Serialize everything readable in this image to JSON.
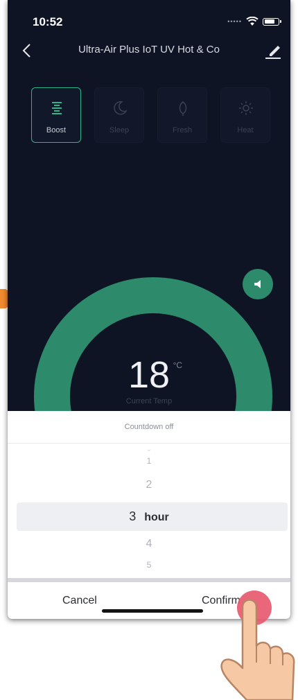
{
  "status": {
    "time": "10:52"
  },
  "nav": {
    "title": "Ultra-Air Plus IoT UV Hot & Co"
  },
  "modes": [
    {
      "label": "Boost",
      "icon": "boost-icon",
      "active": true
    },
    {
      "label": "Sleep",
      "icon": "moon-icon",
      "active": false
    },
    {
      "label": "Fresh",
      "icon": "leaf-icon",
      "active": false
    },
    {
      "label": "Heat",
      "icon": "sun-icon",
      "active": false
    }
  ],
  "temperature": {
    "value": "18",
    "unit": "°C",
    "label": "Current Temp"
  },
  "sheet": {
    "title": "Countdown off",
    "options": [
      "1",
      "2",
      "3",
      "4",
      "5"
    ],
    "selected": "3",
    "unit": "hour",
    "cancel_label": "Cancel",
    "confirm_label": "Confirm"
  },
  "colors": {
    "background": "#0f1424",
    "accent": "#2d8a6b",
    "active_border": "#2fb58a",
    "tap_indicator": "#e85970",
    "arrow": "#f28a2e"
  }
}
